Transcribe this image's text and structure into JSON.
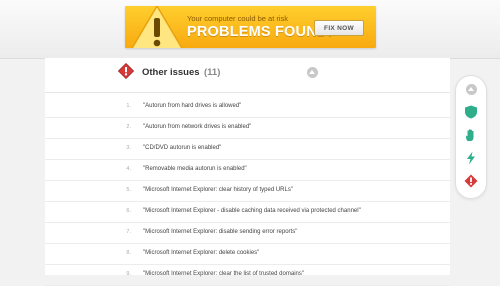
{
  "banner": {
    "subtitle": "Your computer could be at risk",
    "headline": "PROBLEMS FOUND!",
    "fix_label": "FIX NOW"
  },
  "section": {
    "title": "Other issues",
    "count": "(11)"
  },
  "issues": [
    {
      "num": "1.",
      "text": "\"Autorun from hard drives is allowed\""
    },
    {
      "num": "2.",
      "text": "\"Autorun from network drives is enabled\""
    },
    {
      "num": "3.",
      "text": "\"CD/DVD autorun is enabled\""
    },
    {
      "num": "4.",
      "text": "\"Removable media autorun is enabled\""
    },
    {
      "num": "5.",
      "text": "\"Microsoft Internet Explorer: clear history of typed URLs\""
    },
    {
      "num": "6.",
      "text": "\"Microsoft Internet Explorer - disable caching data received via protected channel\""
    },
    {
      "num": "7.",
      "text": "\"Microsoft Internet Explorer: disable sending error reports\""
    },
    {
      "num": "8.",
      "text": "\"Microsoft Internet Explorer: delete cookies\""
    },
    {
      "num": "9.",
      "text": "\"Microsoft Internet Explorer: clear the list of trusted domains\""
    }
  ],
  "side_nav": [
    "scroll-up-icon",
    "shield-icon",
    "hand-icon",
    "lightning-icon",
    "warning-diamond-icon"
  ],
  "colors": {
    "banner": "#f8aa10",
    "warning_red": "#d63a3a",
    "nav_green": "#2fae8c"
  }
}
